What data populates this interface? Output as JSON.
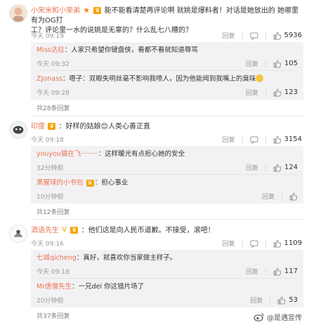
{
  "comments": [
    {
      "user": "小宋米和小荣弟",
      "text_line1": "能不能看清楚再评论啊 就姚是爆料者！对话是她放出的 她哪里有为OG打",
      "text_line2": "工？评论里一水的说姚是无辜的？什么乱七八糟的？",
      "time": "今天 09:19",
      "likes": "5936",
      "replies": [
        {
          "user": "Miss达拉",
          "text": "人家只希望你键盘侠，看都不看就知道辱骂",
          "time": "今天 09:32",
          "likes": "105"
        },
        {
          "user": "ZJonass",
          "text": "嗯子：双眼失明丝毫不影响我喷人，因为他能闻到我嘴上的臭味",
          "time": "今天 09:28",
          "likes": "123"
        }
      ],
      "more": "共28条回复"
    },
    {
      "user": "印度",
      "text": "好样的姑娘😊人类心善正直",
      "time": "今天 09:18",
      "likes": "3154",
      "replies": [
        {
          "user": "youyou猫在飞········",
          "text": "这样暖光有点担心她的安全",
          "time": "32分钟前",
          "likes": "124"
        },
        {
          "user": "黑猩球的小书包",
          "text": "担心事业",
          "time": "10分钟前",
          "likes": ""
        }
      ],
      "more": "共12条回复"
    },
    {
      "user": "酒语先生",
      "text": "他们这是向人民币道歉。不接受，滚吧！",
      "time": "今天 09:16",
      "likes": "1109",
      "replies": [
        {
          "user": "七城qicheng",
          "text": "真好，就喜欢你当家做主样子。",
          "time": "今天 09:18",
          "likes": "117"
        },
        {
          "user": "Mr唐僧先生",
          "text": "一兄dei 你这错片场了",
          "time": "20分钟前",
          "likes": "53"
        }
      ],
      "more": "共37条回复"
    }
  ],
  "actions": {
    "report": "回复",
    "reply": "回复"
  },
  "watermark": "@是遇宣传",
  "colors": {
    "username": "#eb7350",
    "reply_bg": "#f2f2f5",
    "link": "#eb7350"
  }
}
